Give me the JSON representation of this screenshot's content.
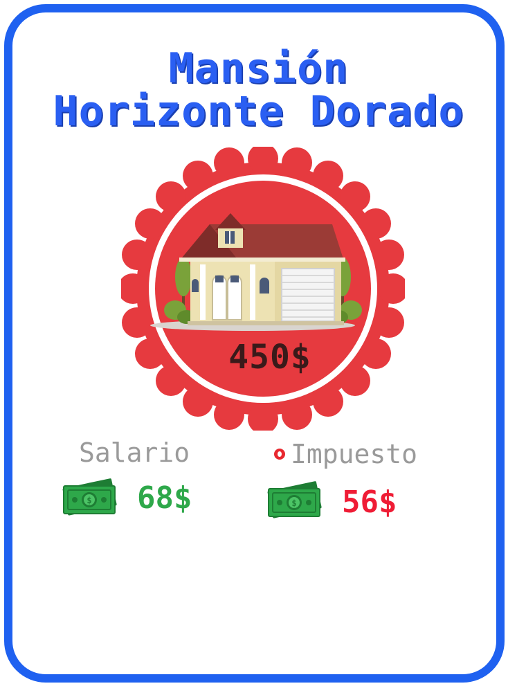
{
  "card": {
    "title_line1": "Mansión",
    "title_line2": "Horizonte Dorado",
    "price": "450$",
    "salary": {
      "label": "Salario",
      "amount": "68$"
    },
    "tax": {
      "label": "Impuesto",
      "amount": "56$"
    }
  },
  "colors": {
    "border": "#1f61f0",
    "title": "#2a5ff2",
    "badge_red": "#e63a3f",
    "salary_green": "#2ea84a",
    "tax_red": "#ef1c35",
    "label_gray": "#9a9a9a"
  },
  "icons": {
    "badge": "house-icon",
    "salary": "money-icon",
    "tax": "money-icon",
    "tax_marker": "alert-dot-icon"
  }
}
